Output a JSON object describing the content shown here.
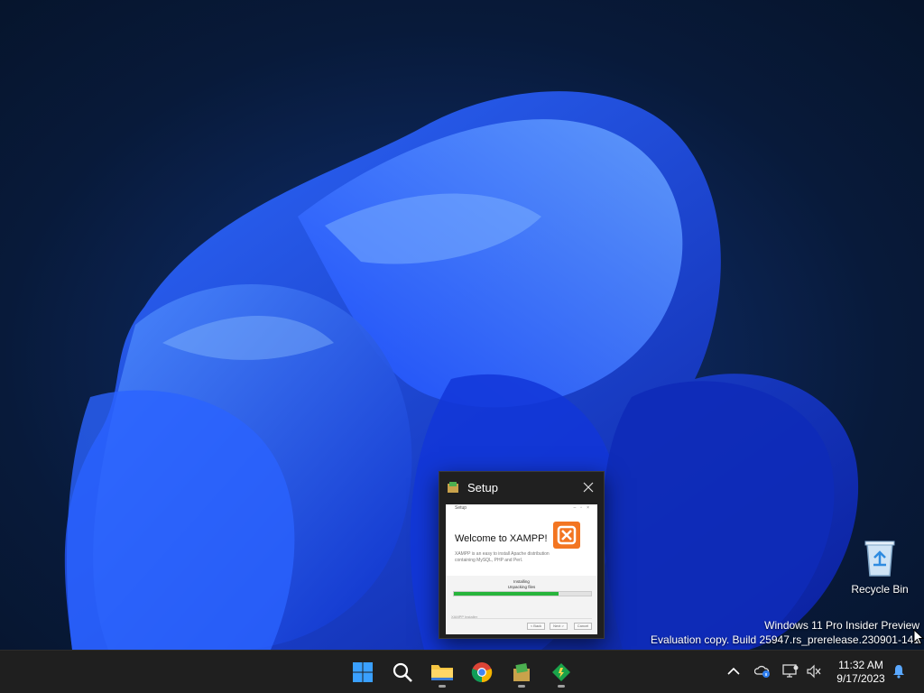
{
  "desktop": {
    "recycle_bin_label": "Recycle Bin",
    "watermark_line1": "Windows 11 Pro Insider Preview",
    "watermark_line2": "Evaluation copy. Build 25947.rs_prerelease.230901-141"
  },
  "setup_window": {
    "title": "Setup",
    "inner_title": "Setup",
    "welcome": "Welcome to XAMPP!",
    "description": "XAMPP is an easy to install Apache distribution containing MySQL, PHP and Perl.",
    "status_line1": "Installing",
    "status_line2": "Unpacking files",
    "progress": 0.76,
    "footer_label": "XAMPP Installer",
    "back_label": "< Back",
    "next_label": "Next >",
    "cancel_label": "Cancel",
    "logo_color": "#f37521",
    "progress_color": "#27b43b"
  },
  "taskbar": {
    "apps": [
      {
        "name": "start",
        "icon": "windows-logo-icon"
      },
      {
        "name": "search",
        "icon": "search-icon"
      },
      {
        "name": "file-explorer",
        "icon": "folder-icon"
      },
      {
        "name": "chrome",
        "icon": "chrome-icon"
      },
      {
        "name": "xampp-setup",
        "icon": "installer-icon"
      },
      {
        "name": "app",
        "icon": "green-diamond-icon"
      }
    ],
    "tray": {
      "time": "11:32 AM",
      "date": "9/17/2023"
    }
  }
}
